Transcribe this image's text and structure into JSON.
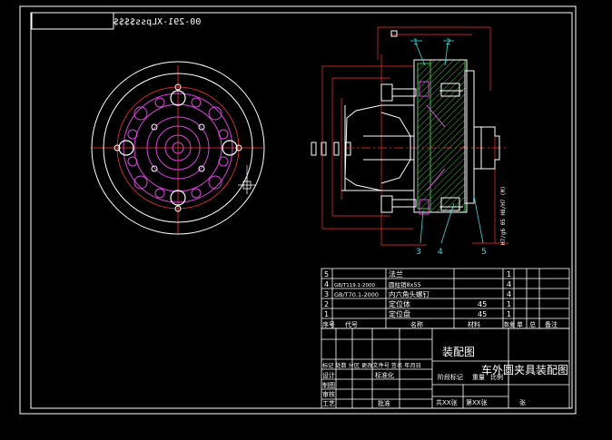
{
  "drawing_number_mirrored": "00-291-XLpss$$$$",
  "balloons": [
    "1",
    "2",
    "3",
    "4",
    "5"
  ],
  "dimension_label_right": "H7/g6 05 H8/H7 (M)",
  "parts_list": [
    {
      "no": "5",
      "code": "",
      "name": "法兰",
      "qty": "1",
      "material": "",
      "mass": ""
    },
    {
      "no": "4",
      "code": "GB/T119.1-2000",
      "name": "圆柱销8x55",
      "qty": "4",
      "material": "",
      "mass": ""
    },
    {
      "no": "3",
      "code": "GB/T70.1-2000",
      "name": "内六角头螺钉",
      "qty": "4",
      "material": "",
      "mass": ""
    },
    {
      "no": "2",
      "code": "",
      "name": "定位体",
      "qty": "1",
      "material": "45",
      "mass": ""
    },
    {
      "no": "1",
      "code": "",
      "name": "定位盘",
      "qty": "1",
      "material": "45",
      "mass": ""
    }
  ],
  "parts_header": {
    "seq": "序号",
    "code": "代号",
    "name": "名称",
    "qty": "数量",
    "material": "材料",
    "single": "单",
    "total": "总",
    "mass": "重量",
    "remark": "备注"
  },
  "title_block": {
    "drawing_name": "装配图",
    "product_name": "车外圆夹具装配图",
    "row_mark": "标记 处数 分区 更改文件号 签名 年月日",
    "designer": "设计",
    "standardization": "标准化",
    "stage_mark": "阶段标记",
    "weight": "重量",
    "scale": "比例",
    "drafter": "制图",
    "reviewer": "审核",
    "process": "工艺",
    "approve": "批准",
    "sheets_total": "共XX张",
    "sheet_no": "第XX张",
    "sheet_unit": "张"
  }
}
